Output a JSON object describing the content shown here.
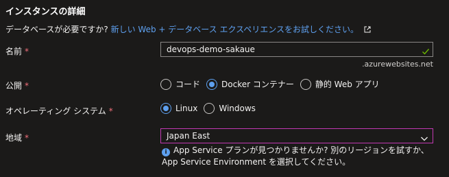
{
  "section": {
    "title": "インスタンスの詳細"
  },
  "intro": {
    "text": "データベースが必要ですか?",
    "link": "新しい Web + データベース エクスペリエンスをお試しください。",
    "link_icon": "external-link-icon"
  },
  "name_field": {
    "label": "名前",
    "required_mark": "*",
    "value": "devops-demo-sakaue",
    "suffix": ".azurewebsites.net",
    "valid_icon": "checkmark-icon"
  },
  "publish": {
    "label": "公開",
    "required_mark": "*",
    "options": [
      "コード",
      "Docker コンテナー",
      "静的 Web アプリ"
    ],
    "selected": "Docker コンテナー"
  },
  "os": {
    "label": "オペレーティング システム",
    "required_mark": "*",
    "options": [
      "Linux",
      "Windows"
    ],
    "selected": "Linux"
  },
  "region": {
    "label": "地域",
    "required_mark": "*",
    "value": "Japan East",
    "info_icon": "info-icon",
    "info_text": "App Service プランが見つかりませんか? 別のリージョンを試すか、App Service Environment を選択してください。"
  },
  "colors": {
    "background": "#1b1a19",
    "link": "#5ea0ef",
    "required": "#f1707b",
    "valid": "#6bb700",
    "focus_border": "#c239b3"
  }
}
